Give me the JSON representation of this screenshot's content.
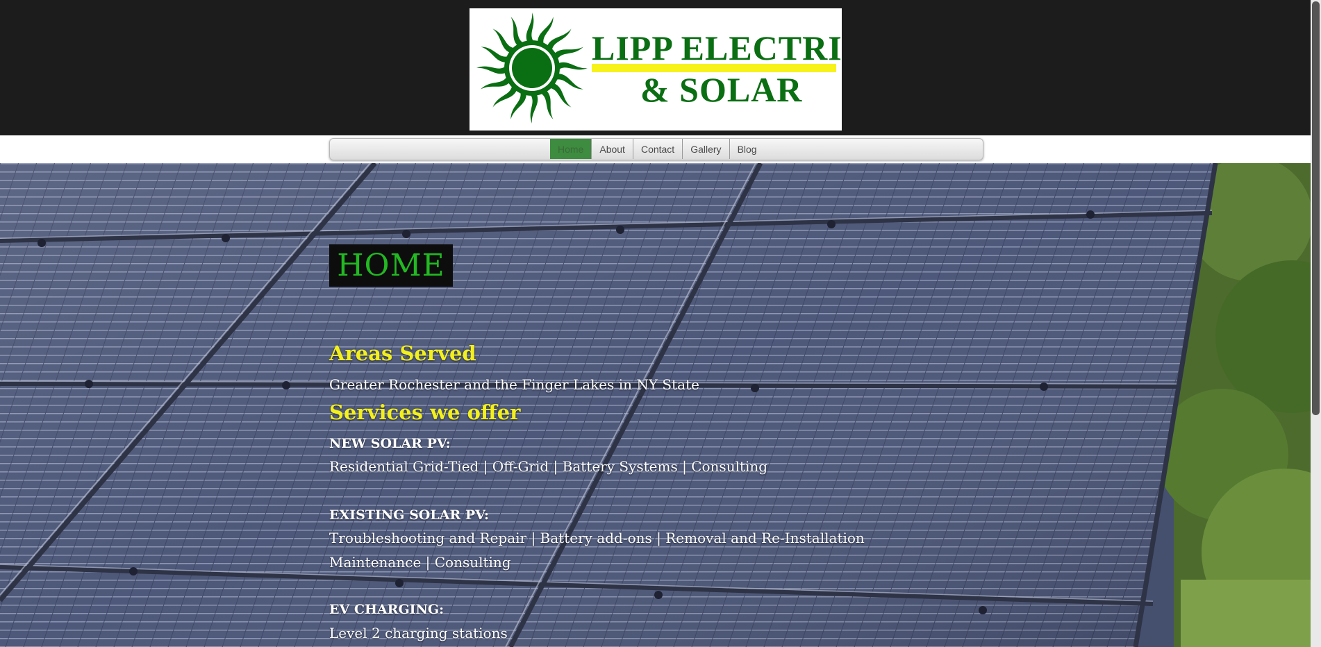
{
  "logo": {
    "line1": "LIPP ELECTRIC",
    "line2": "& SOLAR",
    "colors": {
      "green": "#0a6e12",
      "yellow": "#f7f21a"
    }
  },
  "nav": {
    "items": [
      {
        "label": "Home",
        "active": true
      },
      {
        "label": "About"
      },
      {
        "label": "Contact"
      },
      {
        "label": "Gallery"
      },
      {
        "label": "Blog"
      }
    ]
  },
  "page": {
    "title": "HOME",
    "areas_heading": "Areas Served",
    "areas_text": "Greater Rochester and the Finger Lakes in NY State",
    "services_heading": "Services we offer",
    "new_solar_label": "NEW SOLAR PV:",
    "new_solar_line": "Residential Grid-Tied | Off-Grid |  Battery Systems  |  Consulting",
    "existing_solar_label": "EXISTING SOLAR PV:",
    "existing_solar_line1": "Troubleshooting and Repair |  Battery add-ons  |  Removal and Re-Installation",
    "existing_solar_line2": "Maintenance  |  Consulting",
    "ev_label": "EV CHARGING:",
    "ev_line": "Level 2 charging stations"
  },
  "colors": {
    "accent_green": "#22b922",
    "heading_yellow": "#f4f01c",
    "header_bg": "#1c1c1c"
  }
}
